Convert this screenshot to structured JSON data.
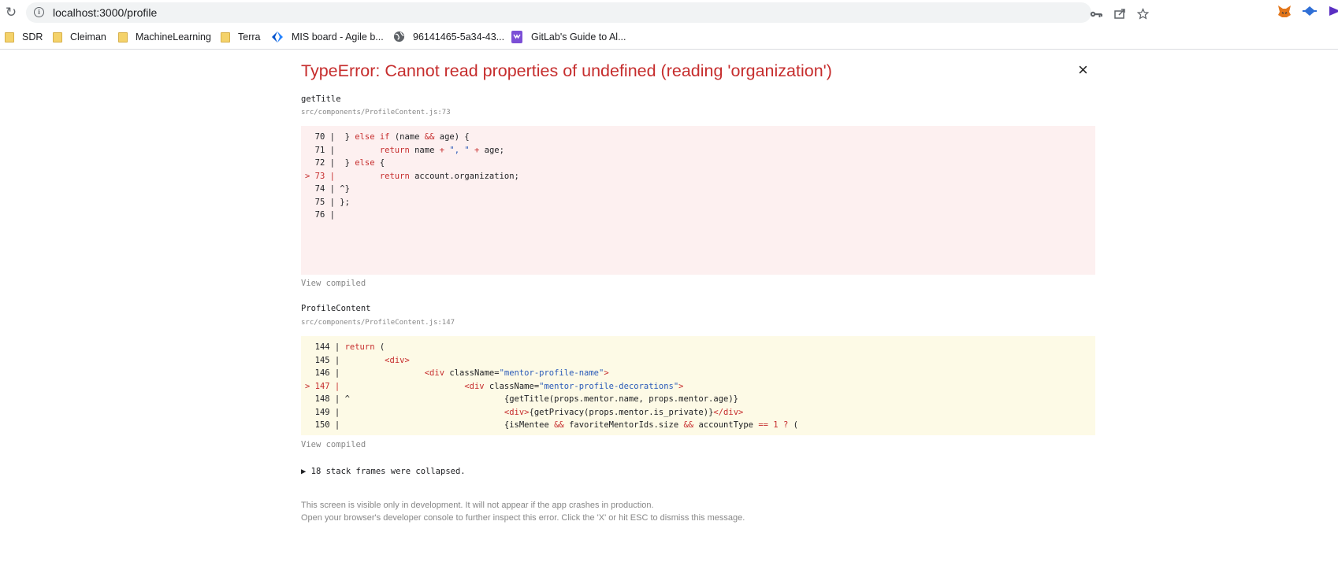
{
  "browser": {
    "reload_icon": "reload-icon",
    "info_icon": "info-icon",
    "url": "localhost:3000/profile",
    "actions": [
      "key-icon",
      "share-icon",
      "star-icon"
    ],
    "extensions": [
      "fox-extension-icon",
      "blue-extension-icon",
      "purple-extension-icon"
    ],
    "bookmarks": [
      {
        "label": "SDR",
        "icon": "folder-icon"
      },
      {
        "label": "Cleiman",
        "icon": "folder-icon"
      },
      {
        "label": "MachineLearning",
        "icon": "folder-icon"
      },
      {
        "label": "Terra",
        "icon": "folder-icon"
      },
      {
        "label": "MIS board - Agile b...",
        "icon": "jira-icon"
      },
      {
        "label": "96141465-5a34-43...",
        "icon": "globe-icon"
      },
      {
        "label": "GitLab's Guide to Al...",
        "icon": "gitlab-guide-icon"
      }
    ]
  },
  "error": {
    "title": "TypeError: Cannot read properties of undefined (reading 'organization')",
    "close_label": "×",
    "frames": [
      {
        "function": "getTitle",
        "location": "src/components/ProfileContent.js:73",
        "lines": [
          {
            "prefix": "  70 |",
            "segments": [
              {
                "t": "  } "
              },
              {
                "t": "else if",
                "c": "kw"
              },
              {
                "t": " (name "
              },
              {
                "t": "&&",
                "c": "kw"
              },
              {
                "t": " age) {"
              }
            ]
          },
          {
            "prefix": "  71 |",
            "segments": [
              {
                "t": "         "
              },
              {
                "t": "return",
                "c": "kw"
              },
              {
                "t": " name "
              },
              {
                "t": "+",
                "c": "kw"
              },
              {
                "t": " "
              },
              {
                "t": "\", \"",
                "c": "str"
              },
              {
                "t": " "
              },
              {
                "t": "+",
                "c": "kw"
              },
              {
                "t": " age;"
              }
            ]
          },
          {
            "prefix": "  72 |",
            "segments": [
              {
                "t": "  } "
              },
              {
                "t": "else",
                "c": "kw"
              },
              {
                "t": " {"
              }
            ]
          },
          {
            "prefix": "> 73 |",
            "marked": true,
            "segments": [
              {
                "t": "         "
              },
              {
                "t": "return",
                "c": "kw"
              },
              {
                "t": " account.organization;"
              }
            ]
          },
          {
            "prefix": "  74 |",
            "segments": [
              {
                "t": " ^}"
              }
            ]
          },
          {
            "prefix": "  75 |",
            "segments": [
              {
                "t": " };"
              }
            ]
          },
          {
            "prefix": "  76 |",
            "segments": []
          }
        ],
        "view_compiled": "View compiled"
      },
      {
        "function": "ProfileContent",
        "location": "src/components/ProfileContent.js:147",
        "lines": [
          {
            "prefix": "  144 |",
            "segments": [
              {
                "t": " "
              },
              {
                "t": "return",
                "c": "kw"
              },
              {
                "t": " ("
              }
            ]
          },
          {
            "prefix": "  145 |",
            "segments": [
              {
                "t": "         "
              },
              {
                "t": "<div>",
                "c": "kw"
              }
            ]
          },
          {
            "prefix": "  146 |",
            "segments": [
              {
                "t": "                 "
              },
              {
                "t": "<div",
                "c": "kw"
              },
              {
                "t": " className="
              },
              {
                "t": "\"mentor-profile-name\"",
                "c": "str"
              },
              {
                "t": ">",
                "c": "kw"
              }
            ]
          },
          {
            "prefix": "> 147 |",
            "marked": true,
            "segments": [
              {
                "t": "                         "
              },
              {
                "t": "<div",
                "c": "kw"
              },
              {
                "t": " className="
              },
              {
                "t": "\"mentor-profile-decorations\"",
                "c": "str"
              },
              {
                "t": ">",
                "c": "kw"
              }
            ]
          },
          {
            "prefix": "  148 |",
            "segments": [
              {
                "t": " ^                               {getTitle(props.mentor.name, props.mentor.age)}"
              }
            ]
          },
          {
            "prefix": "  149 |",
            "segments": [
              {
                "t": "                                 "
              },
              {
                "t": "<div>",
                "c": "kw"
              },
              {
                "t": "{getPrivacy(props.mentor.is_private)}"
              },
              {
                "t": "</div>",
                "c": "kw"
              }
            ]
          },
          {
            "prefix": "  150 |",
            "segments": [
              {
                "t": "                                 {isMentee "
              },
              {
                "t": "&&",
                "c": "kw"
              },
              {
                "t": " favoriteMentorIds.size "
              },
              {
                "t": "&&",
                "c": "kw"
              },
              {
                "t": " accountType "
              },
              {
                "t": "==",
                "c": "kw"
              },
              {
                "t": " "
              },
              {
                "t": "1",
                "c": "kw"
              },
              {
                "t": " "
              },
              {
                "t": "?",
                "c": "kw"
              },
              {
                "t": " ("
              }
            ]
          }
        ],
        "view_compiled": "View compiled"
      }
    ],
    "collapsed": "▶ 18 stack frames were collapsed.",
    "footer_line1": "This screen is visible only in development. It will not appear if the app crashes in production.",
    "footer_line2": "Open your browser's developer console to further inspect this error.  Click the 'X' or hit ESC to dismiss this message."
  }
}
